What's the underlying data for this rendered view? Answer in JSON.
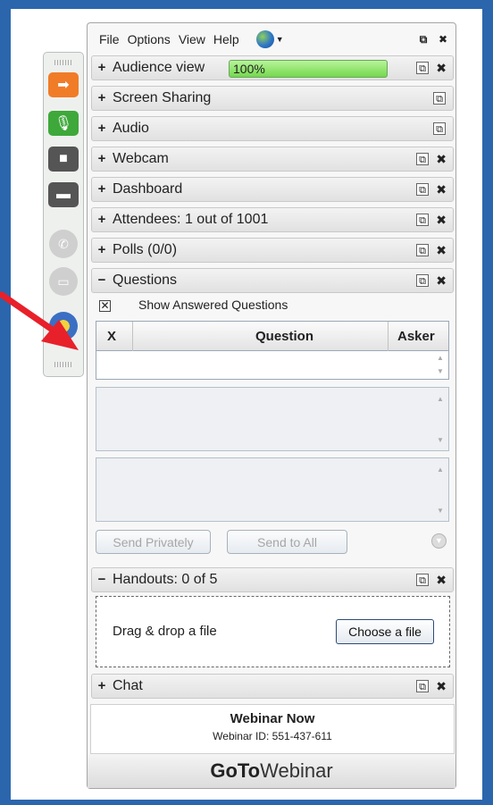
{
  "menu": {
    "file": "File",
    "options": "Options",
    "view": "View",
    "help": "Help"
  },
  "sections": {
    "audience": "Audience view",
    "audience_meter": "100%",
    "screen": "Screen Sharing",
    "audio": "Audio",
    "webcam": "Webcam",
    "dashboard": "Dashboard",
    "attendees": "Attendees:  1 out of 1001",
    "polls": "Polls (0/0)",
    "questions": "Questions",
    "handouts": "Handouts: 0 of 5",
    "chat": "Chat"
  },
  "questions": {
    "show_answered": "Show Answered Questions",
    "col_x": "X",
    "col_question": "Question",
    "col_asker": "Asker",
    "send_privately": "Send Privately",
    "send_all": "Send to All"
  },
  "handouts": {
    "drop_text": "Drag & drop a file",
    "choose": "Choose a file"
  },
  "footer": {
    "webinar_title": "Webinar Now",
    "webinar_id": "Webinar ID: 551-437-611",
    "brand_go": "GoTo",
    "brand_webinar": "Webinar"
  },
  "colors": {
    "background": "#2b66ad",
    "meter": "#74d84e",
    "arrow": "#e8202a"
  }
}
